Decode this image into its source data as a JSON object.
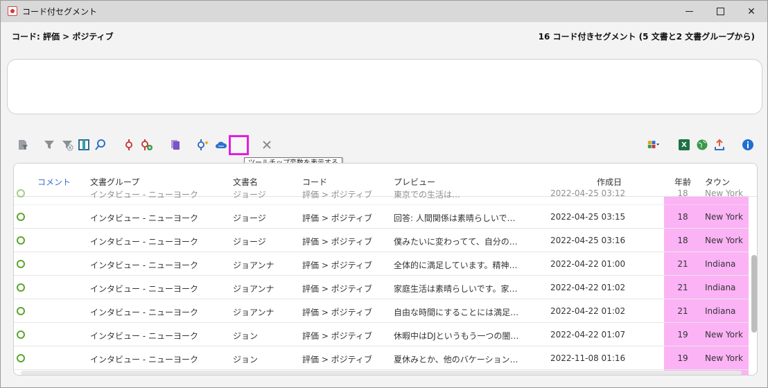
{
  "window": {
    "title": "コード付セグメント"
  },
  "header": {
    "code_path": "コード: 評価 > ポジティブ",
    "segment_count": "16 コード付きセグメント (5 文書と2 文書グループから)"
  },
  "toolbar": {
    "icons": [
      "document-filter-icon",
      "filter-icon",
      "clear-filter-icon",
      "split-view-icon",
      "search-icon",
      "code-icon",
      "add-code-icon",
      "copy-icon",
      "smart-code-icon",
      "cloud-icon",
      "tooltip-variables-icon",
      "close-icon",
      "color-grid-icon",
      "excel-icon",
      "globe-icon",
      "export-icon",
      "info-icon"
    ],
    "tooltip": "ツールチップ変数を表示する",
    "highlight_color": "#e21ee0"
  },
  "table": {
    "columns": {
      "comment": "コメント",
      "group": "文書グループ",
      "document": "文書名",
      "code": "コード",
      "preview": "プレビュー",
      "created": "作成日",
      "age": "年齢",
      "town": "タウン"
    },
    "highlight_color": "#fbb3f5",
    "partial_row": {
      "group": "インタビュー - ニューヨーク",
      "document": "ジョージ",
      "code": "評価 > ポジティブ",
      "preview": "東京での生活は…",
      "created": "2022-04-25 03:12",
      "age": "18",
      "town": "New York"
    },
    "rows": [
      {
        "group": "インタビュー - ニューヨーク",
        "document": "ジョージ",
        "code": "評価 > ポジティブ",
        "preview": "回答: 人間関係は素晴らしいで…",
        "created": "2022-04-25 03:15",
        "age": "18",
        "town": "New York"
      },
      {
        "group": "インタビュー - ニューヨーク",
        "document": "ジョージ",
        "code": "評価 > ポジティブ",
        "preview": "僕みたいに変わってて、自分の…",
        "created": "2022-04-25 03:16",
        "age": "18",
        "town": "New York"
      },
      {
        "group": "インタビュー - ニューヨーク",
        "document": "ジョアンナ",
        "code": "評価 > ポジティブ",
        "preview": "全体的に満足しています。精神…",
        "created": "2022-04-22 01:00",
        "age": "21",
        "town": "Indiana"
      },
      {
        "group": "インタビュー - ニューヨーク",
        "document": "ジョアンナ",
        "code": "評価 > ポジティブ",
        "preview": "家庭生活は素晴らしいです。家…",
        "created": "2022-04-22 01:02",
        "age": "21",
        "town": "Indiana"
      },
      {
        "group": "インタビュー - ニューヨーク",
        "document": "ジョアンナ",
        "code": "評価 > ポジティブ",
        "preview": "自由な時間にすることには満足…",
        "created": "2022-04-22 01:02",
        "age": "21",
        "town": "Indiana"
      },
      {
        "group": "インタビュー - ニューヨーク",
        "document": "ジョン",
        "code": "評価 > ポジティブ",
        "preview": "休暇中はDJというもう一つの闇…",
        "created": "2022-04-22 01:07",
        "age": "19",
        "town": "New York"
      },
      {
        "group": "インタビュー - ニューヨーク",
        "document": "ジョン",
        "code": "評価 > ポジティブ",
        "preview": "夏休みとか、他のバケーション…",
        "created": "2022-11-08 01:16",
        "age": "19",
        "town": "New York"
      }
    ]
  }
}
